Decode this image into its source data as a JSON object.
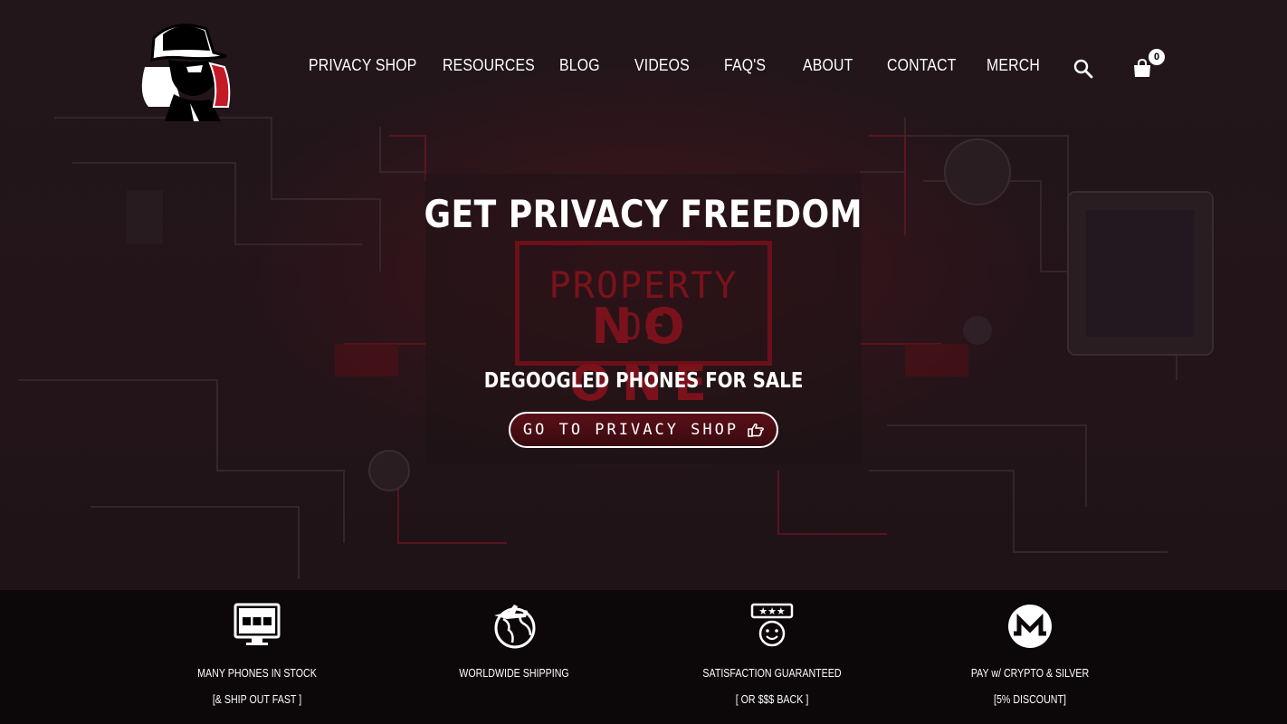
{
  "nav": {
    "items": [
      {
        "label": "PRIVACY SHOP"
      },
      {
        "label": "RESOURCES"
      },
      {
        "label": "BLOG"
      },
      {
        "label": "VIDEOS"
      },
      {
        "label": "FAQ'S"
      },
      {
        "label": "ABOUT"
      },
      {
        "label": "CONTACT"
      },
      {
        "label": "MERCH"
      }
    ],
    "search_icon": "search-icon",
    "cart_icon": "shopping-bag-icon",
    "cart_count": "0"
  },
  "hero": {
    "headline": "GET PRIVACY FREEDOM",
    "stamp_line1": "PROPERTY OF",
    "stamp_line2": "NO ONE",
    "subheadline": "DEGOOGLED PHONES FOR SALE",
    "cta_label": "GO TO PRIVACY SHOP",
    "cta_icon": "pointing-hand-icon"
  },
  "features": [
    {
      "icon": "monitor-boxes-icon",
      "title": "MANY PHONES IN STOCK",
      "subtitle": "[& SHIP OUT FAST ]"
    },
    {
      "icon": "globe-plane-icon",
      "title": "WORLDWIDE SHIPPING",
      "subtitle": ""
    },
    {
      "icon": "rating-smiley-icon",
      "title": "SATISFACTION GUARANTEED",
      "subtitle": "[ OR $$$ BACK ]"
    },
    {
      "icon": "monero-icon",
      "title": "PAY w/ CRYPTO & SILVER",
      "subtitle": "[5% DISCOUNT]"
    }
  ],
  "colors": {
    "background": "#1c1317",
    "accent_red": "#7a121c",
    "features_bg": "#0c0709",
    "text": "#ffffff"
  }
}
